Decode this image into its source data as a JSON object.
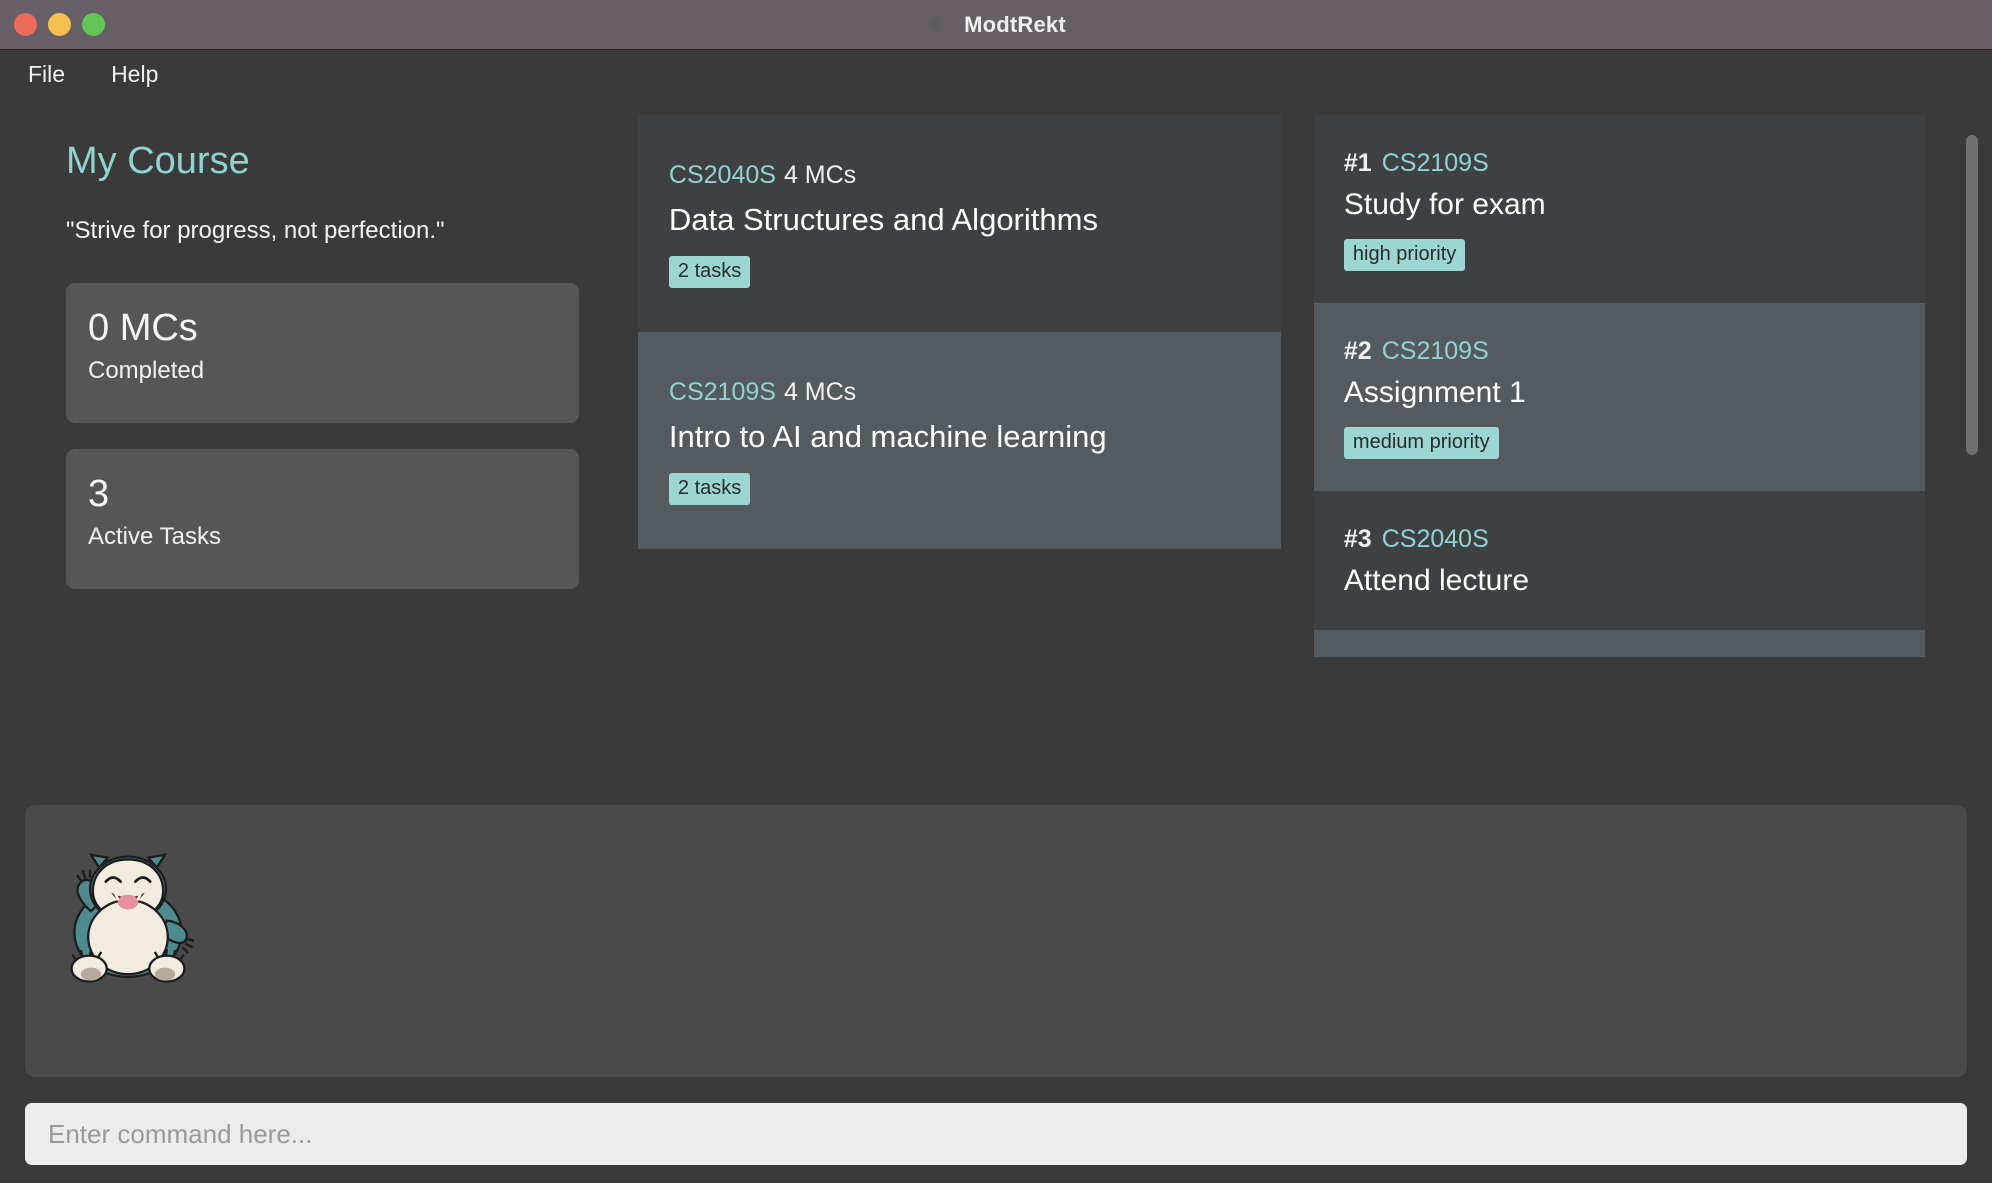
{
  "window": {
    "title": "ModtRekt",
    "icon": "puzzle-piece-icon",
    "controls": {
      "close": "close",
      "minimize": "minimize",
      "maximize": "maximize"
    }
  },
  "menubar": {
    "items": [
      {
        "label": "File"
      },
      {
        "label": "Help"
      }
    ]
  },
  "sidebar": {
    "title": "My Course",
    "quote": "\"Strive for progress, not perfection.\"",
    "stats": [
      {
        "value": "0 MCs",
        "label": "Completed"
      },
      {
        "value": "3",
        "label": "Active Tasks"
      }
    ]
  },
  "courses": [
    {
      "code": "CS2040S",
      "mcs": "4 MCs",
      "name": "Data Structures and Algorithms",
      "tasks_badge": "2 tasks",
      "selected": false
    },
    {
      "code": "CS2109S",
      "mcs": "4 MCs",
      "name": "Intro to AI and machine learning",
      "tasks_badge": "2 tasks",
      "selected": true
    }
  ],
  "tasks": [
    {
      "number": "#1",
      "code": "CS2109S",
      "name": "Study for exam",
      "priority": "high priority",
      "selected": false
    },
    {
      "number": "#2",
      "code": "CS2109S",
      "name": "Assignment 1",
      "priority": "medium priority",
      "selected": true
    },
    {
      "number": "#3",
      "code": "CS2040S",
      "name": "Attend lecture",
      "priority": "",
      "selected": false
    }
  ],
  "mascot": {
    "name": "snorlax-sprite"
  },
  "command": {
    "placeholder": "Enter command here...",
    "value": ""
  },
  "colors": {
    "accent_teal": "#8fd4ce",
    "badge_bg": "#9cd6d2",
    "page_bg": "#3a3a3a",
    "card_bg": "#3f4042",
    "card_selected_bg": "#545a5d",
    "stat_card_bg": "#565656",
    "titlebar_bg": "#666066",
    "input_bg": "#ececec"
  }
}
